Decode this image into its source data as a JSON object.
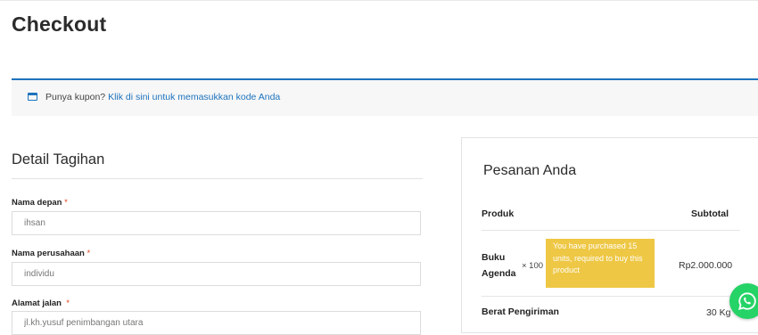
{
  "page": {
    "title": "Checkout"
  },
  "coupon": {
    "prompt": "Punya kupon?",
    "link": "Klik di sini untuk memasukkan kode Anda",
    "icon": "calendar-icon"
  },
  "billing": {
    "title": "Detail Tagihan",
    "required_mark": "*",
    "fields": [
      {
        "label": "Nama depan",
        "value": "ihsan"
      },
      {
        "label": "Nama perusahaan",
        "value": "individu"
      },
      {
        "label": "Alamat jalan",
        "value": "jl.kh.yusuf penimbangan utara"
      }
    ]
  },
  "order": {
    "title": "Pesanan Anda",
    "headers": {
      "product": "Produk",
      "subtotal": "Subtotal"
    },
    "items": [
      {
        "name": "Buku Agenda",
        "qty": "× 100",
        "subtotal": "Rp2.000.000",
        "tooltip": "You have purchased 15 units, required to buy this product"
      }
    ],
    "shipping": {
      "label": "Berat Pengiriman",
      "value": "30 Kg"
    }
  },
  "colors": {
    "accent": "#1e73be",
    "required": "#e2401c",
    "tooltip": "#eec744",
    "whatsapp": "#25d366"
  },
  "floating": {
    "icon": "whatsapp-icon"
  }
}
